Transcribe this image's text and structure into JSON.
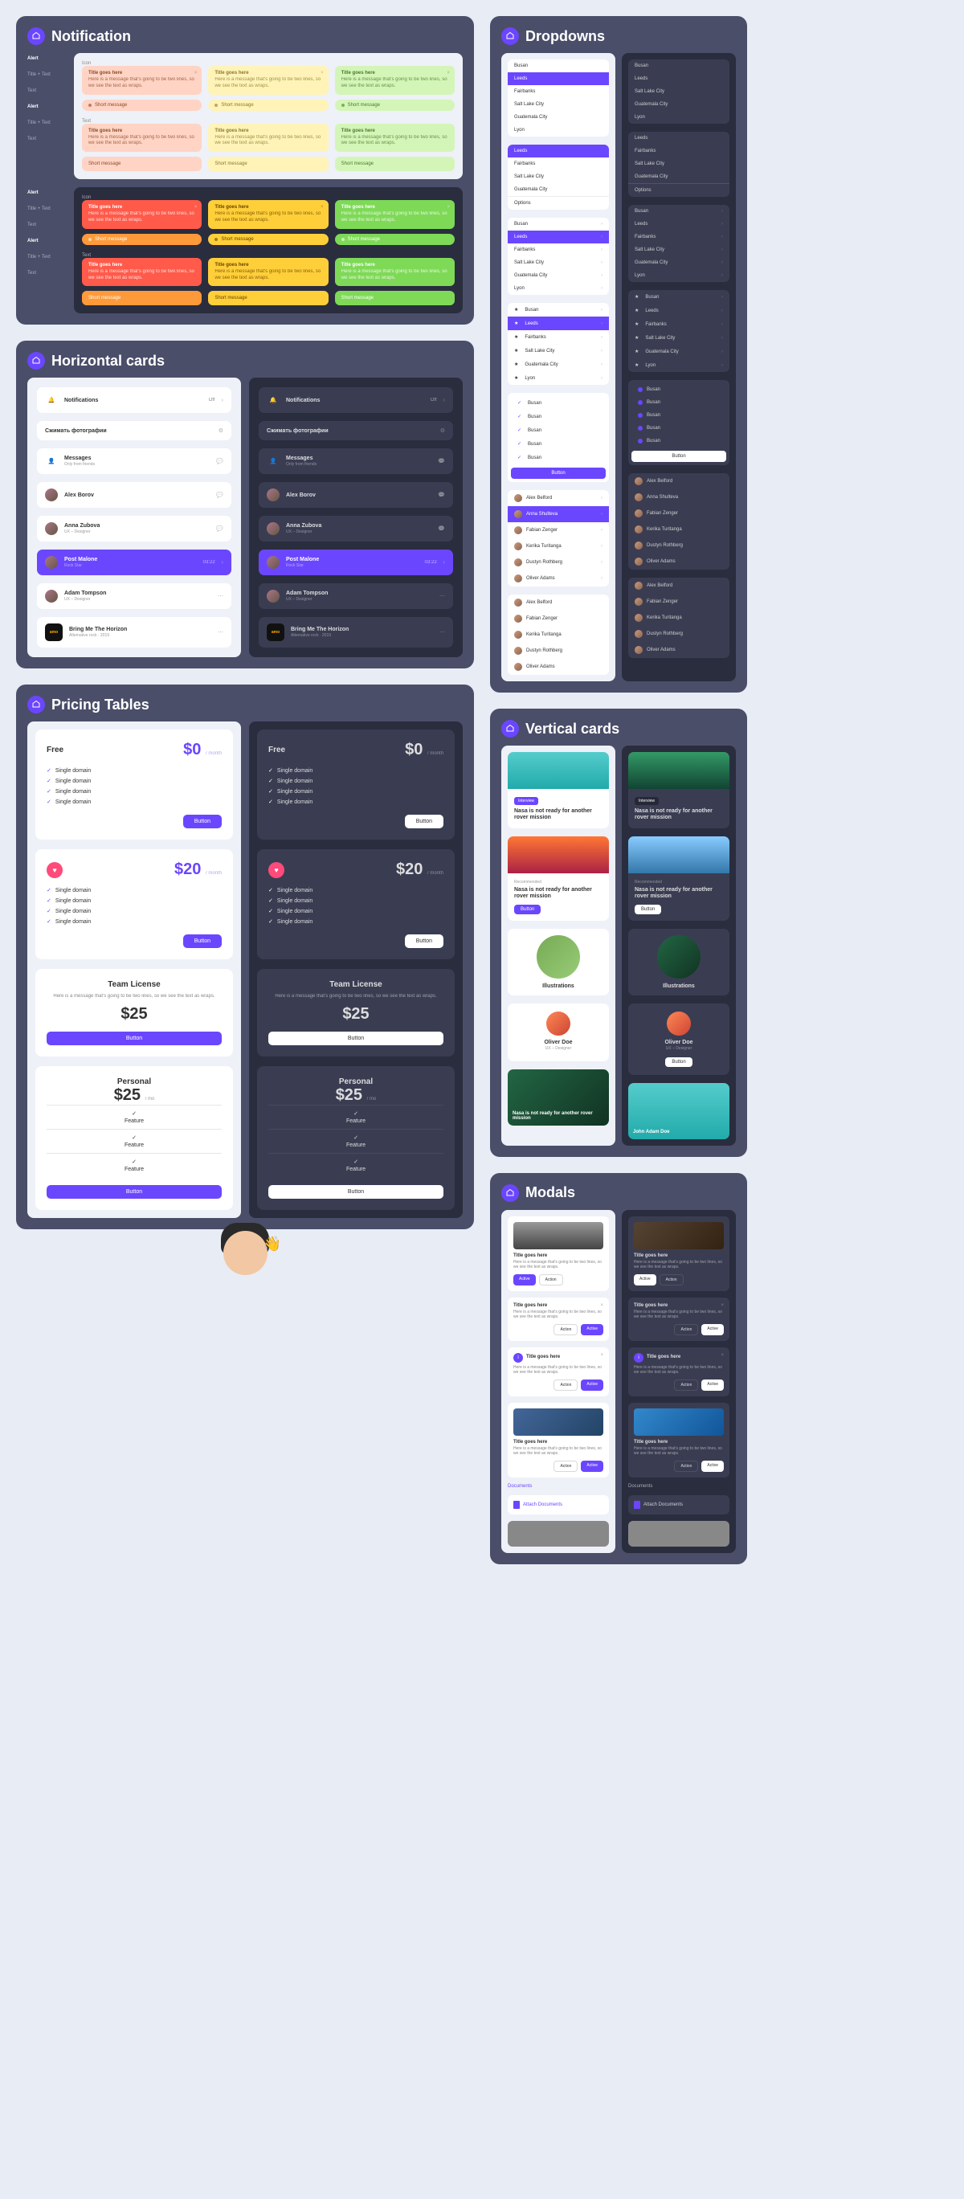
{
  "sections": {
    "notification": "Notification",
    "horizontal": "Horizontal cards",
    "pricing": "Pricing Tables",
    "dropdowns": "Dropdowns",
    "vertical": "Vertical cards",
    "modals": "Modals"
  },
  "notif": {
    "side": {
      "alert": "Alert",
      "r1": "Title + Text",
      "r2": "Text"
    },
    "lbl_icon": "Icon",
    "lbl_text": "Text",
    "title": "Title goes here",
    "msg": "Here is a message that's going to be two lines, so we see the text as wraps.",
    "short": "Short message"
  },
  "hcards": {
    "notifications": "Notifications",
    "off": "Off",
    "compress": "Сжимать фотографии",
    "messages": "Messages",
    "messages_sub": "Only from friends",
    "p1": "Alex Borov",
    "p2": "Anna Zubova",
    "p2_sub": "UX – Designer",
    "p3": "Post Malone",
    "p3_sub": "Rock Star",
    "p3_time": "03:22",
    "p4": "Adam Tompson",
    "p4_sub": "UX – Designer",
    "track": "Bring Me The Horizon",
    "track_sub": "Alternative rock · 2019",
    "amo": "amo"
  },
  "pricing": {
    "free": "Free",
    "p0": "$0",
    "per": "/ month",
    "per2": "/ mo",
    "feature": "Single domain",
    "btn": "Button",
    "p20": "$20",
    "team": "Team License",
    "team_msg": "Here is a message that's going to be two lines, so we see the text as wraps.",
    "p25": "$25",
    "personal": "Personal",
    "feat": "Feature"
  },
  "dd": {
    "cities": [
      "Busan",
      "Leeds",
      "Fairbanks",
      "Salt Lake City",
      "Guatemala City",
      "Lyon"
    ],
    "options": "Options",
    "btn": "Button",
    "people": [
      "Alex Belford",
      "Anna Shulteva",
      "Fabian Zenger",
      "Kerika Turitanga",
      "Dustyn Rothberg",
      "Oliver Adams"
    ]
  },
  "vcards": {
    "tag": "Interview",
    "headline": "Nasa is not ready for another rover mission",
    "rec": "Recommended",
    "btn": "Button",
    "illus": "Illustrations",
    "person": "Oliver Doe",
    "person_sub": "UX – Designer",
    "john": "John Adam Doe"
  },
  "modals": {
    "title": "Title goes here",
    "msg": "Here is a message that's going to be two lines, so we see the text as wraps.",
    "active": "Active",
    "action": "Action",
    "docs": "Documents",
    "attach": "Attach Documents"
  }
}
